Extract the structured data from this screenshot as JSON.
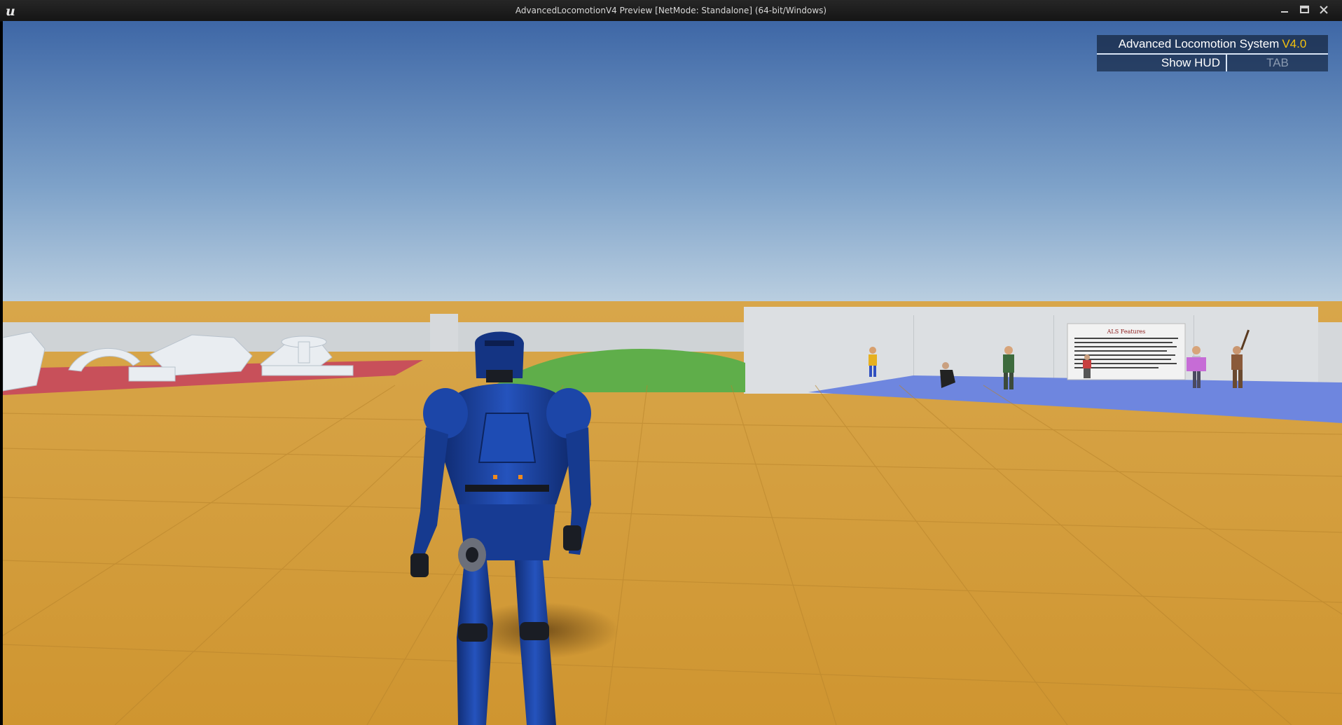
{
  "window": {
    "title": "AdvancedLocomotionV4 Preview [NetMode: Standalone]  (64-bit/Windows)",
    "controls": [
      "minimize",
      "maximize",
      "close"
    ]
  },
  "hud": {
    "title": "Advanced Locomotion System",
    "version": "V4.0",
    "toggle_label": "Show HUD",
    "toggle_key": "TAB"
  },
  "scene": {
    "colors": {
      "sky_top": "#3f6aa8",
      "sky_horizon": "#b9cfe0",
      "floor": "#d9a442",
      "red_zone": "#c94a55",
      "blue_zone": "#6f86e0",
      "hill": "#5fb04a",
      "wall": "#d7dadd",
      "character_armor": "#1f47a8"
    },
    "sign_title": "ALS Features"
  }
}
